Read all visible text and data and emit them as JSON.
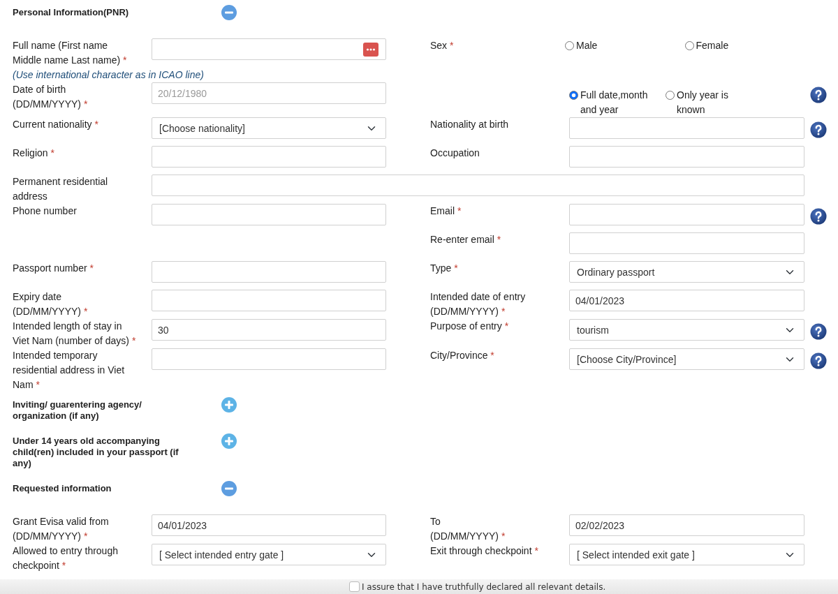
{
  "sections": [
    {
      "title": "Personal Information(PNR)",
      "expanded": true,
      "rows": [
        {
          "left": {
            "label": "Full name (First name Middle name Last name)",
            "mark": "*",
            "note": "(Use international character as in ICAO line)",
            "field": {
              "kind": "text",
              "button": true
            }
          },
          "right": {
            "label": "Sex",
            "mark": "*",
            "field": {
              "kind": "radio",
              "options": [
                {
                  "label": "Male",
                  "selected": false
                },
                {
                  "label": "Female",
                  "selected": false
                }
              ]
            }
          }
        },
        {
          "left": {
            "label": "Date of birth",
            "hint": "(DD/MM/YYYY)",
            "mark": "*",
            "field": {
              "kind": "text",
              "placeholder": "20/12/1980"
            }
          },
          "right": {
            "field": {
              "kind": "radio",
              "options": [
                {
                  "label": "Full date,month and year",
                  "selected": true
                },
                {
                  "label": "Only year is known",
                  "selected": false
                }
              ]
            },
            "help": true
          }
        },
        {
          "left": {
            "label": "Current nationality",
            "mark": "*",
            "field": {
              "kind": "select",
              "value": "[Choose nationality]"
            }
          },
          "right": {
            "label": "Nationality at birth",
            "field": {
              "kind": "text"
            },
            "help": true
          }
        },
        {
          "left": {
            "label": "Religion",
            "mark": "*",
            "field": {
              "kind": "text"
            }
          },
          "right": {
            "label": "Occupation",
            "field": {
              "kind": "text"
            }
          }
        },
        {
          "wide": true,
          "left": {
            "label": "Permanent residential address",
            "field": {
              "kind": "text"
            }
          }
        },
        {
          "left": {
            "label": "Phone number",
            "field": {
              "kind": "text"
            }
          },
          "right": {
            "label": "Email",
            "mark": "*",
            "field": {
              "kind": "text"
            },
            "help": true
          }
        },
        {
          "right": {
            "label": "Re-enter email",
            "mark": "*",
            "field": {
              "kind": "text"
            }
          }
        },
        {
          "left": {
            "label": "Passport number",
            "mark": "*",
            "field": {
              "kind": "text"
            }
          },
          "right": {
            "label": "Type",
            "mark": "*",
            "field": {
              "kind": "select",
              "value": "Ordinary passport"
            }
          }
        },
        {
          "left": {
            "label": "Expiry date",
            "hint": "(DD/MM/YYYY)",
            "mark": "*",
            "field": {
              "kind": "text"
            }
          },
          "right": {
            "label": "Intended date of entry",
            "hint": "(DD/MM/YYYY)",
            "mark": "*",
            "field": {
              "kind": "text",
              "value": "04/01/2023"
            }
          }
        },
        {
          "left": {
            "label": "Intended length of stay in Viet Nam (number of days)",
            "mark": "*",
            "field": {
              "kind": "text",
              "value": "30"
            }
          },
          "right": {
            "label": "Purpose of entry",
            "mark": "*",
            "field": {
              "kind": "select",
              "value": "tourism"
            },
            "help": true
          }
        },
        {
          "left": {
            "label": "Intended temporary residential address in Viet Nam",
            "mark": "*",
            "field": {
              "kind": "text"
            }
          },
          "right": {
            "label": "City/Province",
            "mark": "*",
            "field": {
              "kind": "select",
              "value": "[Choose City/Province]"
            },
            "help": true
          }
        }
      ]
    },
    {
      "title": "Inviting/ guarentering agency/ organization (if any)",
      "expanded": false
    },
    {
      "title": "Under 14 years old accompanying child(ren) included in your passport (if any)",
      "expanded": false
    },
    {
      "title": "Requested information",
      "expanded": true,
      "rows": [
        {
          "left": {
            "label": "Grant Evisa valid from",
            "hint": "(DD/MM/YYYY)",
            "mark": "*",
            "field": {
              "kind": "text",
              "value": "04/01/2023"
            }
          },
          "right": {
            "label": "To",
            "hint": "(DD/MM/YYYY)",
            "mark": "*",
            "field": {
              "kind": "text",
              "value": "02/02/2023"
            }
          }
        },
        {
          "left": {
            "label": "Allowed to entry through checkpoint",
            "mark": "*",
            "field": {
              "kind": "select",
              "value": "[ Select intended entry gate ]"
            }
          },
          "right": {
            "label": "Exit through checkpoint",
            "mark": "*",
            "field": {
              "kind": "select",
              "value": "[ Select intended exit gate ]"
            }
          }
        }
      ]
    }
  ],
  "declaration": {
    "checked": false,
    "text": "I assure that I have truthfully declared all relevant details."
  }
}
